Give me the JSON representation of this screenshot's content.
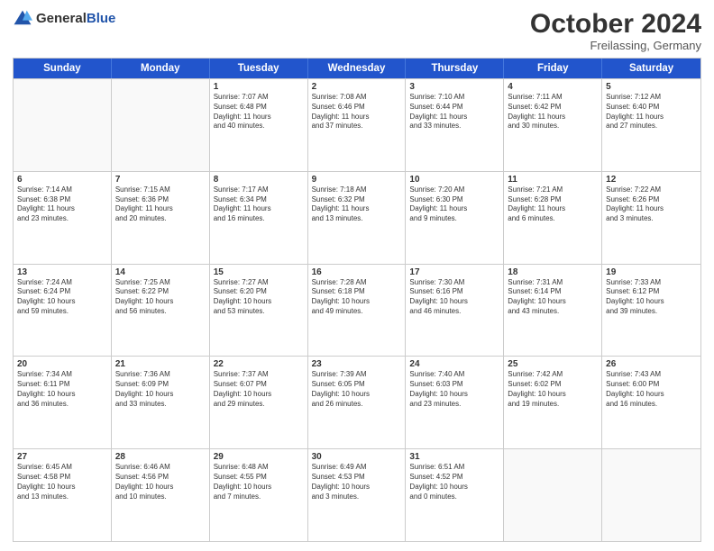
{
  "logo": {
    "general": "General",
    "blue": "Blue"
  },
  "title": "October 2024",
  "subtitle": "Freilassing, Germany",
  "days": [
    "Sunday",
    "Monday",
    "Tuesday",
    "Wednesday",
    "Thursday",
    "Friday",
    "Saturday"
  ],
  "rows": [
    [
      {
        "day": "",
        "empty": true
      },
      {
        "day": "",
        "empty": true
      },
      {
        "day": "1",
        "lines": [
          "Sunrise: 7:07 AM",
          "Sunset: 6:48 PM",
          "Daylight: 11 hours",
          "and 40 minutes."
        ]
      },
      {
        "day": "2",
        "lines": [
          "Sunrise: 7:08 AM",
          "Sunset: 6:46 PM",
          "Daylight: 11 hours",
          "and 37 minutes."
        ]
      },
      {
        "day": "3",
        "lines": [
          "Sunrise: 7:10 AM",
          "Sunset: 6:44 PM",
          "Daylight: 11 hours",
          "and 33 minutes."
        ]
      },
      {
        "day": "4",
        "lines": [
          "Sunrise: 7:11 AM",
          "Sunset: 6:42 PM",
          "Daylight: 11 hours",
          "and 30 minutes."
        ]
      },
      {
        "day": "5",
        "lines": [
          "Sunrise: 7:12 AM",
          "Sunset: 6:40 PM",
          "Daylight: 11 hours",
          "and 27 minutes."
        ]
      }
    ],
    [
      {
        "day": "6",
        "lines": [
          "Sunrise: 7:14 AM",
          "Sunset: 6:38 PM",
          "Daylight: 11 hours",
          "and 23 minutes."
        ]
      },
      {
        "day": "7",
        "lines": [
          "Sunrise: 7:15 AM",
          "Sunset: 6:36 PM",
          "Daylight: 11 hours",
          "and 20 minutes."
        ]
      },
      {
        "day": "8",
        "lines": [
          "Sunrise: 7:17 AM",
          "Sunset: 6:34 PM",
          "Daylight: 11 hours",
          "and 16 minutes."
        ]
      },
      {
        "day": "9",
        "lines": [
          "Sunrise: 7:18 AM",
          "Sunset: 6:32 PM",
          "Daylight: 11 hours",
          "and 13 minutes."
        ]
      },
      {
        "day": "10",
        "lines": [
          "Sunrise: 7:20 AM",
          "Sunset: 6:30 PM",
          "Daylight: 11 hours",
          "and 9 minutes."
        ]
      },
      {
        "day": "11",
        "lines": [
          "Sunrise: 7:21 AM",
          "Sunset: 6:28 PM",
          "Daylight: 11 hours",
          "and 6 minutes."
        ]
      },
      {
        "day": "12",
        "lines": [
          "Sunrise: 7:22 AM",
          "Sunset: 6:26 PM",
          "Daylight: 11 hours",
          "and 3 minutes."
        ]
      }
    ],
    [
      {
        "day": "13",
        "lines": [
          "Sunrise: 7:24 AM",
          "Sunset: 6:24 PM",
          "Daylight: 10 hours",
          "and 59 minutes."
        ]
      },
      {
        "day": "14",
        "lines": [
          "Sunrise: 7:25 AM",
          "Sunset: 6:22 PM",
          "Daylight: 10 hours",
          "and 56 minutes."
        ]
      },
      {
        "day": "15",
        "lines": [
          "Sunrise: 7:27 AM",
          "Sunset: 6:20 PM",
          "Daylight: 10 hours",
          "and 53 minutes."
        ]
      },
      {
        "day": "16",
        "lines": [
          "Sunrise: 7:28 AM",
          "Sunset: 6:18 PM",
          "Daylight: 10 hours",
          "and 49 minutes."
        ]
      },
      {
        "day": "17",
        "lines": [
          "Sunrise: 7:30 AM",
          "Sunset: 6:16 PM",
          "Daylight: 10 hours",
          "and 46 minutes."
        ]
      },
      {
        "day": "18",
        "lines": [
          "Sunrise: 7:31 AM",
          "Sunset: 6:14 PM",
          "Daylight: 10 hours",
          "and 43 minutes."
        ]
      },
      {
        "day": "19",
        "lines": [
          "Sunrise: 7:33 AM",
          "Sunset: 6:12 PM",
          "Daylight: 10 hours",
          "and 39 minutes."
        ]
      }
    ],
    [
      {
        "day": "20",
        "lines": [
          "Sunrise: 7:34 AM",
          "Sunset: 6:11 PM",
          "Daylight: 10 hours",
          "and 36 minutes."
        ]
      },
      {
        "day": "21",
        "lines": [
          "Sunrise: 7:36 AM",
          "Sunset: 6:09 PM",
          "Daylight: 10 hours",
          "and 33 minutes."
        ]
      },
      {
        "day": "22",
        "lines": [
          "Sunrise: 7:37 AM",
          "Sunset: 6:07 PM",
          "Daylight: 10 hours",
          "and 29 minutes."
        ]
      },
      {
        "day": "23",
        "lines": [
          "Sunrise: 7:39 AM",
          "Sunset: 6:05 PM",
          "Daylight: 10 hours",
          "and 26 minutes."
        ]
      },
      {
        "day": "24",
        "lines": [
          "Sunrise: 7:40 AM",
          "Sunset: 6:03 PM",
          "Daylight: 10 hours",
          "and 23 minutes."
        ]
      },
      {
        "day": "25",
        "lines": [
          "Sunrise: 7:42 AM",
          "Sunset: 6:02 PM",
          "Daylight: 10 hours",
          "and 19 minutes."
        ]
      },
      {
        "day": "26",
        "lines": [
          "Sunrise: 7:43 AM",
          "Sunset: 6:00 PM",
          "Daylight: 10 hours",
          "and 16 minutes."
        ]
      }
    ],
    [
      {
        "day": "27",
        "lines": [
          "Sunrise: 6:45 AM",
          "Sunset: 4:58 PM",
          "Daylight: 10 hours",
          "and 13 minutes."
        ]
      },
      {
        "day": "28",
        "lines": [
          "Sunrise: 6:46 AM",
          "Sunset: 4:56 PM",
          "Daylight: 10 hours",
          "and 10 minutes."
        ]
      },
      {
        "day": "29",
        "lines": [
          "Sunrise: 6:48 AM",
          "Sunset: 4:55 PM",
          "Daylight: 10 hours",
          "and 7 minutes."
        ]
      },
      {
        "day": "30",
        "lines": [
          "Sunrise: 6:49 AM",
          "Sunset: 4:53 PM",
          "Daylight: 10 hours",
          "and 3 minutes."
        ]
      },
      {
        "day": "31",
        "lines": [
          "Sunrise: 6:51 AM",
          "Sunset: 4:52 PM",
          "Daylight: 10 hours",
          "and 0 minutes."
        ]
      },
      {
        "day": "",
        "empty": true
      },
      {
        "day": "",
        "empty": true
      }
    ]
  ]
}
